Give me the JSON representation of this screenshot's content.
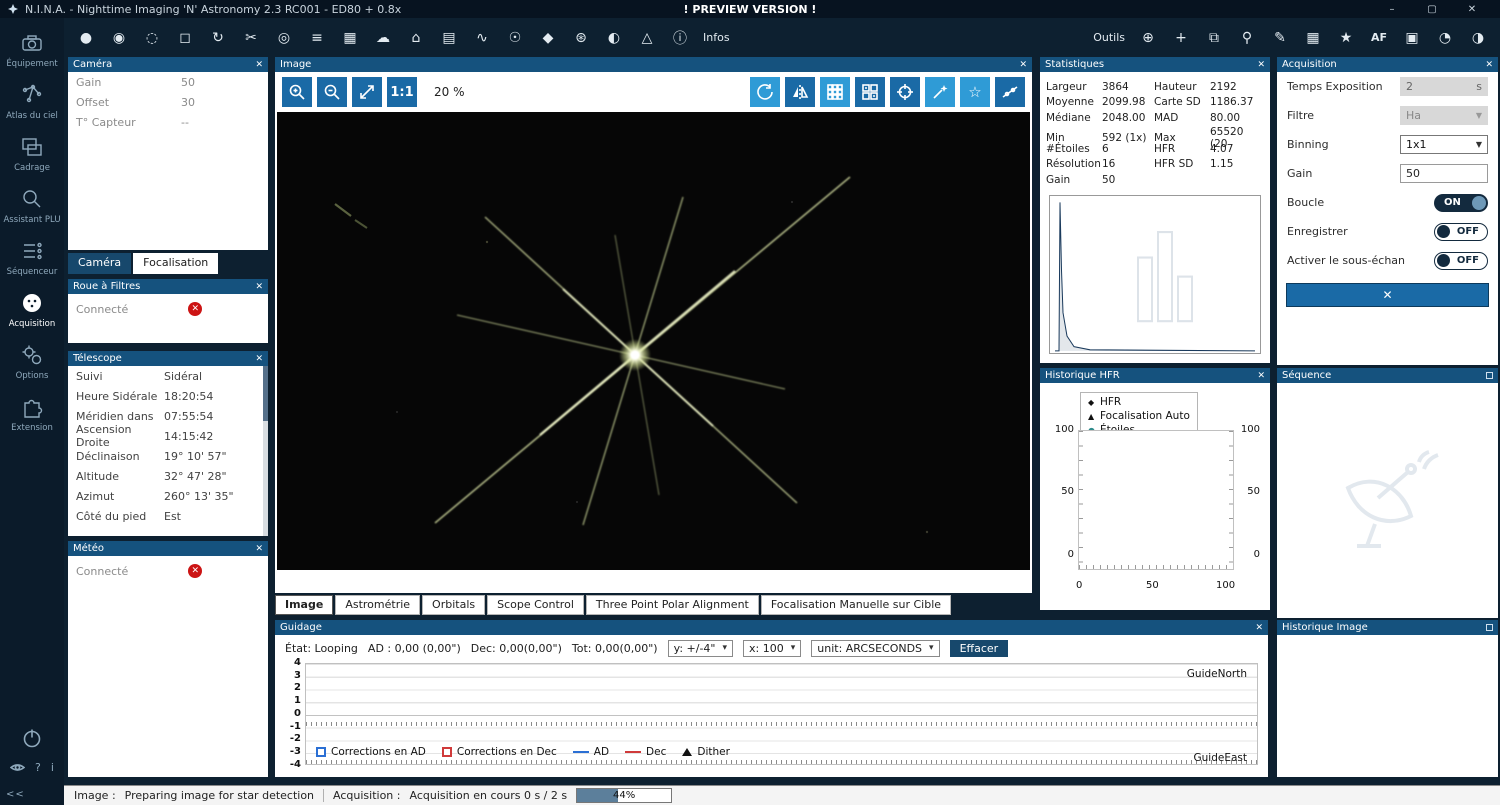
{
  "icons": {
    "close": "✕",
    "caret": "▾"
  },
  "window": {
    "title": "N.I.N.A. - Nighttime Imaging 'N' Astronomy 2.3 RC001  -  ED80 + 0.8x",
    "preview_banner": "! PREVIEW VERSION !",
    "controls": {
      "minimize": "–",
      "maximize": "▢",
      "close": "✕"
    }
  },
  "sidebar": {
    "items": [
      {
        "label": "Équipement"
      },
      {
        "label": "Atlas du ciel"
      },
      {
        "label": "Cadrage"
      },
      {
        "label": "Assistant PLU"
      },
      {
        "label": "Séquenceur"
      },
      {
        "label": "Acquisition",
        "active": true
      },
      {
        "label": "Options"
      },
      {
        "label": "Extension"
      }
    ],
    "footer": {
      "help": "?",
      "info": "i",
      "collapse": "<<"
    }
  },
  "toolbar": {
    "infos_label": "Infos",
    "outils_label": "Outils",
    "left_icons": [
      {
        "name": "camera-icon",
        "glyph": "●"
      },
      {
        "name": "filter-wheel-icon",
        "glyph": "◉"
      },
      {
        "name": "focuser-icon",
        "glyph": "◌"
      },
      {
        "name": "rotator-icon",
        "glyph": "◻"
      },
      {
        "name": "rotate-icon",
        "glyph": "↻"
      },
      {
        "name": "guider-icon",
        "glyph": "✂"
      },
      {
        "name": "telescope-icon",
        "glyph": "◎"
      },
      {
        "name": "switch-icon",
        "glyph": "≡"
      },
      {
        "name": "grid-panel-icon",
        "glyph": "▦"
      },
      {
        "name": "cloud-icon",
        "glyph": "☁"
      },
      {
        "name": "dome-icon",
        "glyph": "⌂"
      },
      {
        "name": "flat-panel-icon",
        "glyph": "▤"
      },
      {
        "name": "signal-icon",
        "glyph": "∿"
      },
      {
        "name": "bulb-icon",
        "glyph": "☉"
      },
      {
        "name": "shield-icon",
        "glyph": "◆"
      },
      {
        "name": "flower-icon",
        "glyph": "⊛"
      },
      {
        "name": "moon-icon",
        "glyph": "◐"
      },
      {
        "name": "horizon-icon",
        "glyph": "△"
      },
      {
        "name": "info-icon",
        "glyph": "ⓘ"
      }
    ],
    "right_icons": [
      {
        "name": "plugin-icon",
        "glyph": "⊕"
      },
      {
        "name": "move-icon",
        "glyph": "+"
      },
      {
        "name": "layers-icon",
        "glyph": "⧉"
      },
      {
        "name": "search-icon",
        "glyph": "⚲"
      },
      {
        "name": "brush-icon",
        "glyph": "✎"
      },
      {
        "name": "table-icon",
        "glyph": "▦"
      },
      {
        "name": "star-icon",
        "glyph": "★"
      },
      {
        "name": "autofocus-icon",
        "glyph": "AF"
      },
      {
        "name": "frame-icon",
        "glyph": "▣"
      },
      {
        "name": "history-icon",
        "glyph": "◔"
      },
      {
        "name": "theme-icon",
        "glyph": "◑"
      }
    ]
  },
  "camera_panel": {
    "title": "Caméra",
    "rows": [
      {
        "label": "Gain",
        "value": "50"
      },
      {
        "label": "Offset",
        "value": "30"
      },
      {
        "label": "T° Capteur",
        "value": "--"
      }
    ]
  },
  "left_tabs": {
    "camera": "Caméra",
    "focus": "Focalisation"
  },
  "filter_wheel": {
    "title": "Roue à Filtres",
    "status": "Connecté"
  },
  "telescope": {
    "title": "Télescope",
    "rows": [
      {
        "label": "Suivi",
        "value": "Sidéral"
      },
      {
        "label": "Heure Sidérale",
        "value": "18:20:54"
      },
      {
        "label": "Méridien dans",
        "value": "07:55:54"
      },
      {
        "label": "Ascension Droite",
        "value": "14:15:42"
      },
      {
        "label": "Déclinaison",
        "value": "19° 10' 57\""
      },
      {
        "label": "Altitude",
        "value": "32° 47' 28\""
      },
      {
        "label": "Azimut",
        "value": "260° 13' 35\""
      },
      {
        "label": "Côté du pied",
        "value": "Est"
      }
    ]
  },
  "weather": {
    "title": "Météo",
    "status": "Connecté"
  },
  "image_panel": {
    "title": "Image",
    "zoom_actual": "1:1",
    "zoom_level": "20 %",
    "tabs": [
      "Image",
      "Astrométrie",
      "Orbitals",
      "Scope Control",
      "Three Point Polar Alignment",
      "Focalisation Manuelle sur Cible"
    ],
    "active_tab": "Image"
  },
  "guidage": {
    "title": "Guidage",
    "state": "État: Looping",
    "ad": "AD : 0,00 (0,00\")",
    "dec": "Dec: 0,00(0,00\")",
    "tot": "Tot: 0,00(0,00\")",
    "y_scale": "y: +/-4\"",
    "x_scale": "x: 100",
    "unit": "unit: ARCSECONDS",
    "clear_button": "Effacer",
    "y_ticks": [
      "4",
      "3",
      "2",
      "1",
      "0",
      "-1",
      "-2",
      "-3",
      "-4"
    ],
    "north_label": "GuideNorth",
    "east_label": "GuideEast",
    "legend": {
      "corr_ad": "Corrections en AD",
      "corr_dec": "Corrections en Dec",
      "ad": "AD",
      "dec": "Dec",
      "dither": "Dither"
    },
    "colors": {
      "ad": "#2b6fd4",
      "dec": "#d03a3a"
    }
  },
  "statistics": {
    "title": "Statistiques",
    "cells": [
      {
        "l": "Largeur",
        "v": "3864",
        "l2": "Hauteur",
        "v2": "2192"
      },
      {
        "l": "Moyenne",
        "v": "2099.98",
        "l2": "Carte SD",
        "v2": "1186.37"
      },
      {
        "l": "Médiane",
        "v": "2048.00",
        "l2": "MAD",
        "v2": "80.00"
      },
      {
        "l": "Min",
        "v": "592 (1x)",
        "l2": "Max",
        "v2": "65520 (20"
      },
      {
        "l": "#Étoiles",
        "v": "6",
        "l2": "HFR",
        "v2": "4.07"
      },
      {
        "l": "Résolution",
        "v": "16",
        "l2": "HFR SD",
        "v2": "1.15"
      },
      {
        "l": "Gain",
        "v": "50",
        "l2": "",
        "v2": ""
      }
    ]
  },
  "hfr_history": {
    "title": "Historique HFR",
    "legend": [
      {
        "marker": "◆",
        "label": "HFR"
      },
      {
        "marker": "▲",
        "label": "Focalisation Auto"
      },
      {
        "marker": "●",
        "label": "Étoiles"
      }
    ],
    "y_left": [
      "100",
      "50",
      "0"
    ],
    "y_right": [
      "100",
      "50",
      "0"
    ],
    "x_ticks": [
      "0",
      "50",
      "100"
    ],
    "etoiles_color": "#2e8b8b"
  },
  "acquisition_panel": {
    "title": "Acquisition",
    "rows": [
      {
        "label": "Temps Exposition",
        "value": "2",
        "suffix": "s"
      },
      {
        "label": "Filtre",
        "value": "Ha"
      },
      {
        "label": "Binning",
        "value": "1x1"
      },
      {
        "label": "Gain",
        "value": "50"
      },
      {
        "label": "Boucle",
        "value": "ON"
      },
      {
        "label": "Enregistrer",
        "value": "OFF"
      },
      {
        "label": "Activer le sous-échan",
        "value": "OFF"
      }
    ],
    "stop_button": "✕"
  },
  "sequence_panel": {
    "title": "Séquence"
  },
  "image_history_panel": {
    "title": "Historique Image"
  },
  "statusbar": {
    "image_label": "Image :",
    "image_status": "Preparing image for star detection",
    "acq_label": "Acquisition :",
    "acq_status": "Acquisition en cours 0 s / 2 s",
    "progress_percent": "44%",
    "progress_fill_style": "width:44%"
  }
}
